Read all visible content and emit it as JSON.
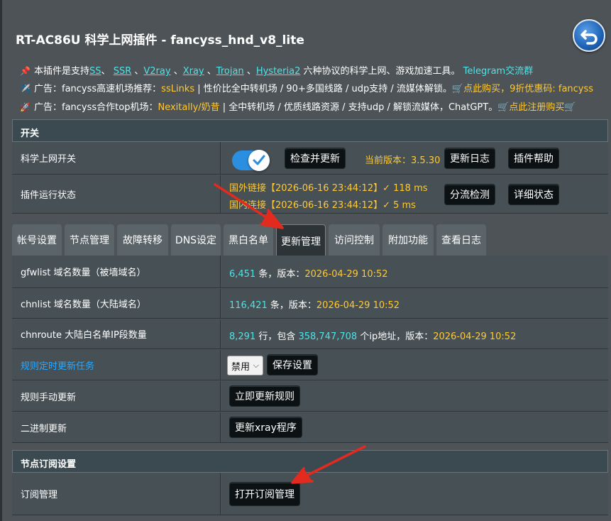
{
  "header": {
    "title": "RT-AC86U 科学上网插件 - fancyss_hnd_v8_lite"
  },
  "info": {
    "line1": {
      "prefix": "本插件是支持",
      "protocols": [
        "SS",
        "SSR",
        "V2ray",
        "Xray",
        "Trojan",
        "Hysteria2"
      ],
      "sep": "、",
      "suffix": "六种协议的科学上网、游戏加速工具。",
      "telegram": "Telegram交流群"
    },
    "line2": {
      "prefix": "广告：fancyss高速机场推荐：",
      "highlight": "ssLinks",
      "middle": " | 性价比全中转机场 / 90+多国线路 / udp支持 / 流媒体解锁。",
      "buy": "点此购买，9折优惠码: fancyss"
    },
    "line3": {
      "prefix": "广告：fancyss合作top机场：",
      "highlight": "Nexitally/奶昔",
      "middle": " | 全中转机场 / 优质线路资源 / 支持udp / 解锁流媒体，ChatGPT。",
      "buy": "点此注册购买"
    }
  },
  "switch_section": {
    "header": "开关",
    "row1_label": "科学上网开关",
    "toggle_on": true,
    "check_update_btn": "检查并更新",
    "version_label": "当前版本：",
    "version": "3.5.30",
    "changelog_btn": "更新日志",
    "help_btn": "插件帮助",
    "row2_label": "插件运行状态",
    "status_foreign_label": "国外链接",
    "status_foreign_time": "【2026-06-16 23:44:12】",
    "status_foreign_ms": "✓ 118 ms",
    "status_domestic_label": "国内连接",
    "status_domestic_time": "【2026-06-16 23:44:12】",
    "status_domestic_ms": "✓ 5 ms",
    "split_btn": "分流检测",
    "detail_btn": "详细状态"
  },
  "tabs": [
    "帐号设置",
    "节点管理",
    "故障转移",
    "DNS设定",
    "黑白名单",
    "更新管理",
    "访问控制",
    "附加功能",
    "查看日志"
  ],
  "active_tab": "更新管理",
  "update": {
    "gfw_label": "gfwlist 域名数量（被墙域名）",
    "gfw_count": "6,451",
    "gfw_unit": " 条，版本：",
    "gfw_ver": "2026-04-29 10:52",
    "chn_label": "chnlist 域名数量（大陆域名）",
    "chn_count": "116,421",
    "chn_unit": " 条，版本：",
    "chn_ver": "2026-04-29 10:52",
    "route_label": "chnroute 大陆白名单IP段数量",
    "route_count": "8,291",
    "route_mid": " 行，包含 ",
    "route_ips": "358,747,708",
    "route_unit": " 个ip地址，版本：",
    "route_ver": "2026-04-29 10:52",
    "sched_label": "规则定时更新任务",
    "sched_value": "禁用",
    "save_btn": "保存设置",
    "manual_label": "规则手动更新",
    "manual_btn": "立即更新规则",
    "binary_label": "二进制更新",
    "binary_btn": "更新xray程序"
  },
  "subscribe": {
    "header": "节点订阅设置",
    "label": "订阅管理",
    "btn": "打开订阅管理"
  },
  "colors": {
    "cyan": "#4de3e8",
    "yellow": "#ffc933",
    "link_blue": "#2aa9ff",
    "toggle_blue": "#2a8fe0",
    "arrow_red": "#e22a1f"
  }
}
